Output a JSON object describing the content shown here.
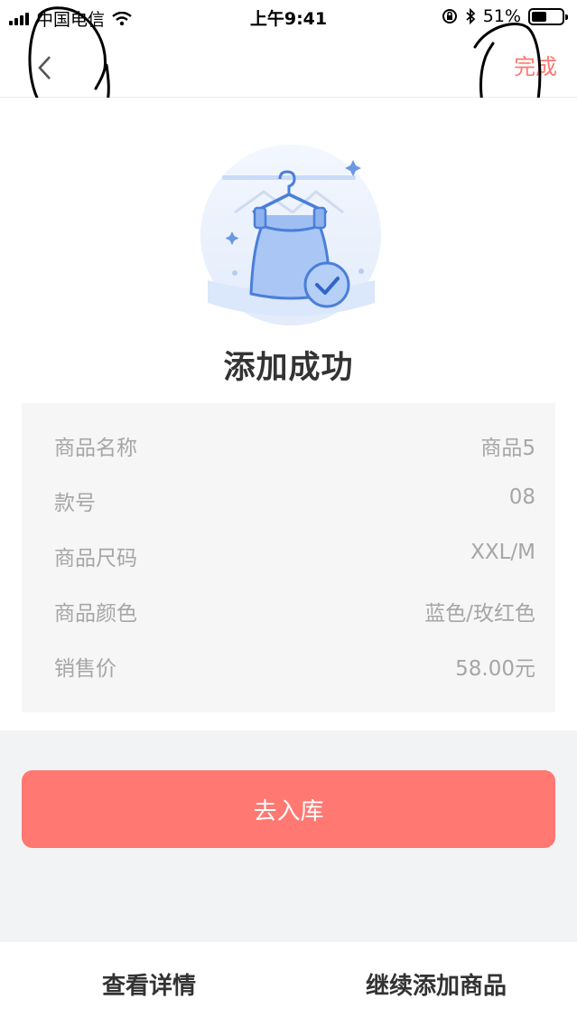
{
  "status_bar": {
    "carrier": "中国电信",
    "time": "上午9:41",
    "battery_percent": "51%",
    "battery_level": 0.51
  },
  "nav": {
    "back_icon": "chevron-left-icon",
    "done_label": "完成",
    "accent_color": "#ff7871"
  },
  "main": {
    "title": "添加成功",
    "illustration": "clothes-hanger-success-icon",
    "details": [
      {
        "label": "商品名称",
        "value": "商品5"
      },
      {
        "label": "款号",
        "value": "08"
      },
      {
        "label": "商品尺码",
        "value": "XXL/M"
      },
      {
        "label": "商品颜色",
        "value": "蓝色/玫红色"
      },
      {
        "label": "销售价",
        "value": "58.00元"
      }
    ]
  },
  "actions": {
    "stock_in_label": "去入库"
  },
  "bottom_bar": {
    "view_details_label": "查看详情",
    "continue_add_label": "继续添加商品"
  }
}
